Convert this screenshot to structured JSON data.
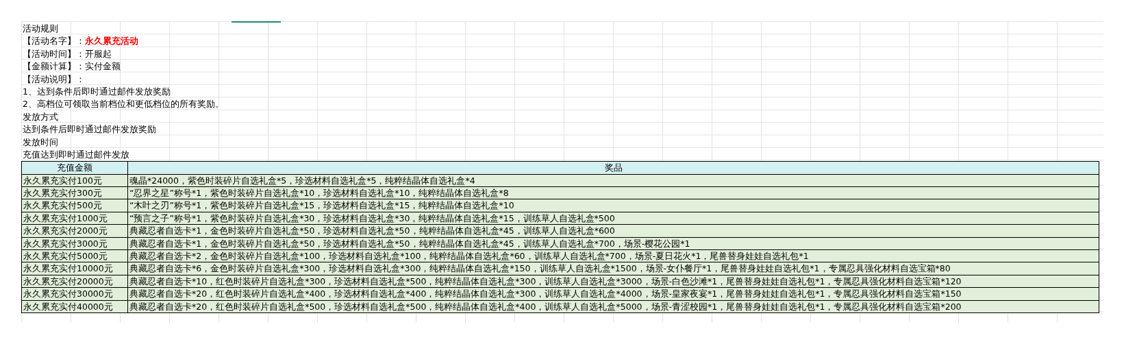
{
  "sheet": {
    "rules": [
      {
        "text": "活动规则"
      },
      {
        "label": "【活动名字】：",
        "value": "永久累充活动",
        "highlight": true
      },
      {
        "label": "【活动时间】：",
        "value": "开服起",
        "highlight": false
      },
      {
        "label": "【金额计算】：",
        "value": "实付金额",
        "highlight": false
      },
      {
        "text": "【活动说明】："
      },
      {
        "text": "1、达到条件后即时通过邮件发放奖励"
      },
      {
        "text": "2、高档位可领取当前档位和更低档位的所有奖励。"
      },
      {
        "text": "发放方式"
      },
      {
        "text": "达到条件后即时通过邮件发放奖励"
      },
      {
        "text": "发放时间"
      },
      {
        "text": "充值达到即时通过邮件发放"
      }
    ],
    "table": {
      "columns": [
        "充值金额",
        "奖品"
      ],
      "rows": [
        {
          "amount": "永久累充实付100元",
          "rewards": "魂晶*24000，紫色时装碎片自选礼盒*5，珍选材料自选礼盒*5，纯粹结晶体自选礼盒*4"
        },
        {
          "amount": "永久累充实付300元",
          "rewards": "“忍界之星”称号*1，紫色时装碎片自选礼盒*10，珍选材料自选礼盒*10，纯粹结晶体自选礼盒*8"
        },
        {
          "amount": "永久累充实付500元",
          "rewards": "“木叶之刃”称号*1，紫色时装碎片自选礼盒*15，珍选材料自选礼盒*15，纯粹结晶体自选礼盒*10"
        },
        {
          "amount": "永久累充实付1000元",
          "rewards": "“预言之子”称号*1，紫色时装碎片自选礼盒*30，珍选材料自选礼盒*30，纯粹结晶体自选礼盒*15，训练草人自选礼盒*500"
        },
        {
          "amount": "永久累充实付2000元",
          "rewards": "典藏忍者自选卡*1，金色时装碎片自选礼盒*50，珍选材料自选礼盒*50，纯粹结晶体自选礼盒*45，训练草人自选礼盒*600"
        },
        {
          "amount": "永久累充实付3000元",
          "rewards": "典藏忍者自选卡*1，金色时装碎片自选礼盒*50，珍选材料自选礼盒*50，纯粹结晶体自选礼盒*45，训练草人自选礼盒*700，场景-樱花公园*1"
        },
        {
          "amount": "永久累充实付5000元",
          "rewards": "典藏忍者自选卡*2，金色时装碎片自选礼盒*100，珍选材料自选礼盒*100，纯粹结晶体自选礼盒*60，训练草人自选礼盒*700，场景-夏日花火*1，尾兽替身娃娃自选礼包*1"
        },
        {
          "amount": "永久累充实付10000元",
          "rewards": "典藏忍者自选卡*6，金色时装碎片自选礼盒*300，珍选材料自选礼盒*300，纯粹结晶体自选礼盒*150，训练草人自选礼盒*1500，场景-女仆餐厅*1，尾兽替身娃娃自选礼包*1，专属忍具强化材料自选宝箱*80"
        },
        {
          "amount": "永久累充实付20000元",
          "rewards": "典藏忍者自选卡*10，红色时装碎片自选礼盒*300，珍选材料自选礼盒*500，纯粹结晶体自选礼盒*300，训练草人自选礼盒*3000，场景-白色沙滩*1，尾兽替身娃娃自选礼包*1，专属忍具强化材料自选宝箱*120"
        },
        {
          "amount": "永久累充实付30000元",
          "rewards": "典藏忍者自选卡*20，红色时装碎片自选礼盒*400，珍选材料自选礼盒*400，纯粹结晶体自选礼盒*300，训练草人自选礼盒*4000，场景-皇家夜宴*1，尾兽替身娃娃自选礼包*1，专属忍具强化材料自选宝箱*150"
        },
        {
          "amount": "永久累充实付40000元",
          "rewards": "典藏忍者自选卡*20，红色时装碎片自选礼盒*500，珍选材料自选礼盒*500，纯粹结晶体自选礼盒*400，训练草人自选礼盒*5000，场景-青涩校园*1，尾兽替身娃娃自选礼包*1，专属忍具强化材料自选宝箱*200"
        }
      ]
    }
  }
}
